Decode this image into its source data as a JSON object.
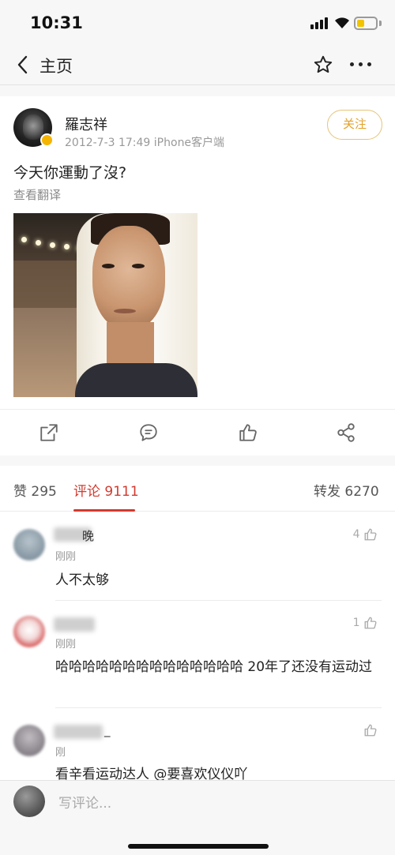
{
  "status_bar": {
    "time": "10:31"
  },
  "nav": {
    "back_label": "主页"
  },
  "post": {
    "author": "羅志祥",
    "meta": "2012-7-3 17:49  iPhone客户端",
    "follow_label": "关注",
    "text": "今天你運動了沒?",
    "translate_label": "查看翻译"
  },
  "tabs": [
    {
      "label": "赞 295"
    },
    {
      "label": "评论 9111"
    },
    {
      "label": "转发 6270"
    }
  ],
  "comments": [
    {
      "name": "晚",
      "time": "刚刚",
      "text": "人不太够",
      "likes": "4"
    },
    {
      "name": "",
      "time": "刚刚",
      "text": "哈哈哈哈哈哈哈哈哈哈哈哈哈哈 20年了还没有运动过",
      "likes": "1"
    },
    {
      "name": "_",
      "time": "刚",
      "text": "看辛看运动达人 @要喜欢仪仪吖",
      "likes": ""
    }
  ],
  "bottom_bar": {
    "input_placeholder": "写评论..."
  },
  "colors": {
    "accent_red": "#d23a2e",
    "follow_gold": "#e2a22c",
    "battery_yellow": "#f2c400"
  },
  "icons": [
    "back-icon",
    "star-icon",
    "more-icon",
    "repost-icon",
    "comment-icon",
    "like-icon",
    "share-icon"
  ]
}
